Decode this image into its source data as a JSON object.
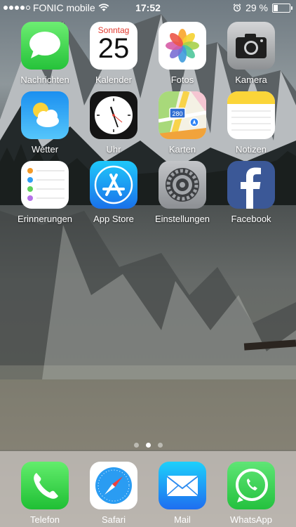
{
  "status_bar": {
    "carrier": "FONIC mobile",
    "signal_bars": 4,
    "time": "17:52",
    "battery_percent": "29 %",
    "battery_level": 0.29
  },
  "apps": [
    {
      "label": "Nachrichten",
      "icon": "messages-icon"
    },
    {
      "label": "Kalender",
      "icon": "calendar-icon",
      "weekday": "Sonntag",
      "date": "25"
    },
    {
      "label": "Fotos",
      "icon": "photos-icon"
    },
    {
      "label": "Kamera",
      "icon": "camera-icon"
    },
    {
      "label": "Wetter",
      "icon": "weather-icon"
    },
    {
      "label": "Uhr",
      "icon": "clock-icon"
    },
    {
      "label": "Karten",
      "icon": "maps-icon",
      "road_number": "280"
    },
    {
      "label": "Notizen",
      "icon": "notes-icon"
    },
    {
      "label": "Erinnerungen",
      "icon": "reminders-icon"
    },
    {
      "label": "App Store",
      "icon": "app-store-icon"
    },
    {
      "label": "Einstellungen",
      "icon": "settings-icon"
    },
    {
      "label": "Facebook",
      "icon": "facebook-icon"
    }
  ],
  "page_indicator": {
    "pages": 3,
    "current": 2
  },
  "dock": [
    {
      "label": "Telefon",
      "icon": "phone-icon"
    },
    {
      "label": "Safari",
      "icon": "safari-icon"
    },
    {
      "label": "Mail",
      "icon": "mail-icon"
    },
    {
      "label": "WhatsApp",
      "icon": "whatsapp-icon"
    }
  ]
}
